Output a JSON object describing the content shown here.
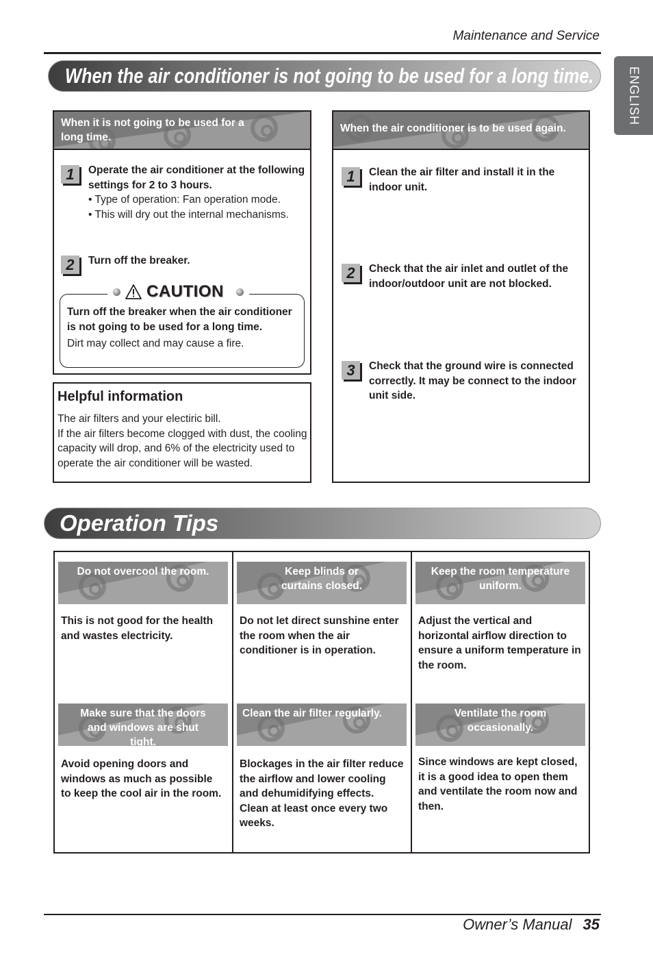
{
  "header": {
    "section": "Maintenance and Service"
  },
  "language_tab": "ENGLISH",
  "long_time": {
    "title": "When the air conditioner is not going to be used for a long time.",
    "not_used": {
      "heading": "When it is not going to be used for a long time.",
      "steps": [
        {
          "number": "1",
          "text": "Operate the air conditioner at the following settings for 2 to 3 hours.",
          "bullets": [
            "• Type of operation: Fan operation mode.",
            "• This will dry out the internal mechanisms."
          ]
        },
        {
          "number": "2",
          "text": "Turn off the breaker."
        }
      ],
      "caution": {
        "label": "CAUTION",
        "bold": "Turn off the breaker when the air conditioner is not going to be used for a long time.",
        "normal": "Dirt may collect and may cause a fire."
      }
    },
    "helpful": {
      "title": "Helpful information",
      "lines": [
        "The air filters and your electiric bill.",
        "If the air filters become clogged with dust, the cooling capacity will drop, and 6% of the electricity used to operate the air conditioner will be wasted."
      ]
    },
    "used_again": {
      "heading": "When the air conditioner is to be used again.",
      "steps": [
        {
          "number": "1",
          "text": "Clean the air filter and install it in the indoor unit."
        },
        {
          "number": "2",
          "text": "Check that the air inlet and outlet of the indoor/outdoor unit are not blocked."
        },
        {
          "number": "3",
          "text": "Check that the ground wire is connected correctly. It may be connect to the indoor unit side."
        }
      ]
    }
  },
  "operation_tips": {
    "title": "Operation Tips",
    "tips": [
      {
        "heading": "Do not overcool the room.",
        "body": "This is not good for the health and wastes electricity."
      },
      {
        "heading": "Keep blinds or curtains closed.",
        "body": "Do not let direct sunshine enter the room when the air conditioner is in operation."
      },
      {
        "heading": "Keep the room temperature uniform.",
        "body": "Adjust the vertical and horizontal airflow direction to ensure a uniform temperature in the room."
      },
      {
        "heading": "Make sure that the doors and windows are shut tight.",
        "body": "Avoid opening doors and windows as much as possible to keep the cool air in the room."
      },
      {
        "heading": "Clean the air filter regularly.",
        "body": "Blockages in the air filter reduce the airflow and lower cooling and dehumidifying effects. Clean at least once every two weeks."
      },
      {
        "heading": "Ventilate the room occasionally.",
        "body": "Since windows are kept closed, it is a good idea to open them and ventilate the room now and then."
      }
    ]
  },
  "footer": {
    "manual": "Owner’s Manual",
    "page": "35"
  },
  "colors": {
    "banner_dark": "#3d3d3d",
    "banner_light": "#d2d2d2",
    "head_gray": "#8c8c8c",
    "text": "#231f20"
  }
}
